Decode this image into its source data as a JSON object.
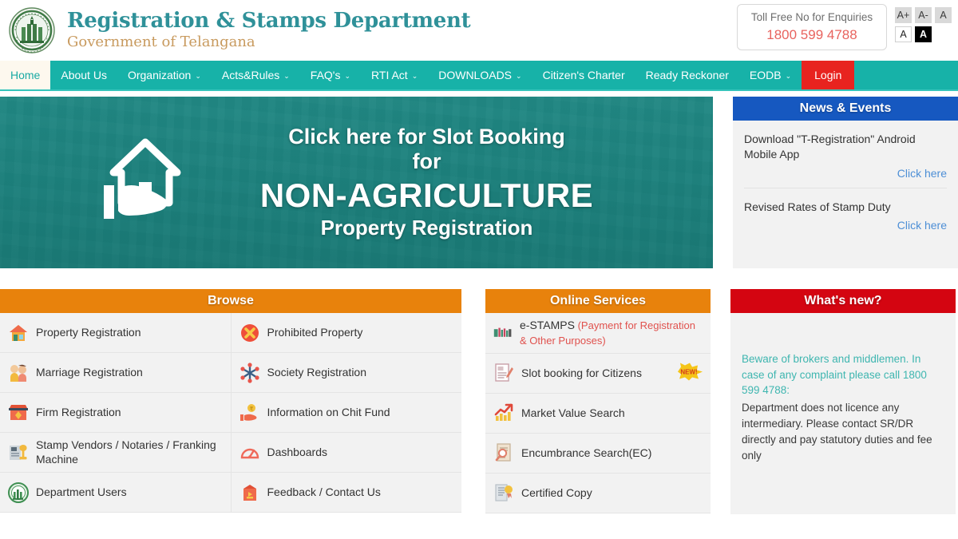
{
  "header": {
    "emblem_icon": "telangana-government-emblem",
    "title": "Registration & Stamps Department",
    "subtitle": "Government of Telangana",
    "tollfree": {
      "label": "Toll Free No for Enquiries",
      "number": "1800 599 4788"
    },
    "accessibility": {
      "increase": "A+",
      "decrease": "A-",
      "reset": "A",
      "normal_contrast": "A",
      "high_contrast": "A"
    }
  },
  "nav": {
    "items": [
      {
        "label": "Home",
        "active": true,
        "caret": false,
        "login": false
      },
      {
        "label": "About Us",
        "active": false,
        "caret": false,
        "login": false
      },
      {
        "label": "Organization",
        "active": false,
        "caret": true,
        "login": false
      },
      {
        "label": "Acts&Rules",
        "active": false,
        "caret": true,
        "login": false
      },
      {
        "label": "FAQ's",
        "active": false,
        "caret": true,
        "login": false
      },
      {
        "label": "RTI Act",
        "active": false,
        "caret": true,
        "login": false
      },
      {
        "label": "DOWNLOADS",
        "active": false,
        "caret": true,
        "login": false
      },
      {
        "label": "Citizen's Charter",
        "active": false,
        "caret": false,
        "login": false
      },
      {
        "label": "Ready Reckoner",
        "active": false,
        "caret": false,
        "login": false
      },
      {
        "label": "EODB",
        "active": false,
        "caret": true,
        "login": false
      },
      {
        "label": "Login",
        "active": false,
        "caret": false,
        "login": true
      }
    ],
    "caret_glyph": "⌄"
  },
  "hero": {
    "line1": "Click here for Slot Booking",
    "line2": "for",
    "line3": "NON-AGRICULTURE",
    "line4": "Property Registration",
    "icon": "house-in-hand-icon"
  },
  "news": {
    "title": "News & Events",
    "items": [
      {
        "text": "Download \"T-Registration\" Android Mobile App",
        "link": "Click here"
      },
      {
        "text": "Revised Rates of Stamp Duty",
        "link": "Click here"
      }
    ]
  },
  "browse": {
    "title": "Browse",
    "left": [
      {
        "label": "Property Registration",
        "icon": "house-icon"
      },
      {
        "label": "Marriage Registration",
        "icon": "couple-icon"
      },
      {
        "label": "Firm Registration",
        "icon": "firm-icon"
      },
      {
        "label": "Stamp Vendors / Notaries / Franking Machine",
        "icon": "stamp-vendor-icon"
      },
      {
        "label": "Department Users",
        "icon": "emblem-icon"
      }
    ],
    "right": [
      {
        "label": "Prohibited Property",
        "icon": "prohibited-cross-icon"
      },
      {
        "label": "Society Registration",
        "icon": "society-network-icon"
      },
      {
        "label": "Information on Chit Fund",
        "icon": "coin-in-hand-icon"
      },
      {
        "label": "Dashboards",
        "icon": "gauge-icon"
      },
      {
        "label": "Feedback / Contact Us",
        "icon": "feedback-box-icon"
      }
    ]
  },
  "services": {
    "title": "Online Services",
    "items": [
      {
        "label": "e-STAMPS",
        "sublabel": " (Payment for Registration & Other Purposes)",
        "icon": "estamps-logo-icon",
        "badge": ""
      },
      {
        "label": "Slot booking for Citizens",
        "sublabel": "",
        "icon": "document-pen-icon",
        "badge": "NEW!"
      },
      {
        "label": "Market Value Search",
        "sublabel": "",
        "icon": "growth-chart-icon",
        "badge": ""
      },
      {
        "label": "Encumbrance Search(EC)",
        "sublabel": "",
        "icon": "document-magnifier-icon",
        "badge": ""
      },
      {
        "label": "Certified Copy",
        "sublabel": "",
        "icon": "certified-document-icon",
        "badge": ""
      }
    ]
  },
  "whats_new": {
    "title": "What's new?",
    "highlight": "Beware of brokers and middlemen. In case of any complaint please call 1800 599 4788:",
    "body": "Department does not licence any intermediary. Please contact SR/DR directly and pay statutory duties and fee only"
  },
  "colors": {
    "nav_teal": "#17b2a8",
    "login_red": "#e8231f",
    "panel_orange": "#e8820c",
    "news_blue": "#1658c0",
    "whats_red": "#d40511",
    "brand_teal": "#2f9199",
    "brand_gold": "#c89a5e",
    "tollfree_red": "#e8635e",
    "link_blue": "#4d8fd6",
    "highlight_teal": "#3fb6b0"
  }
}
